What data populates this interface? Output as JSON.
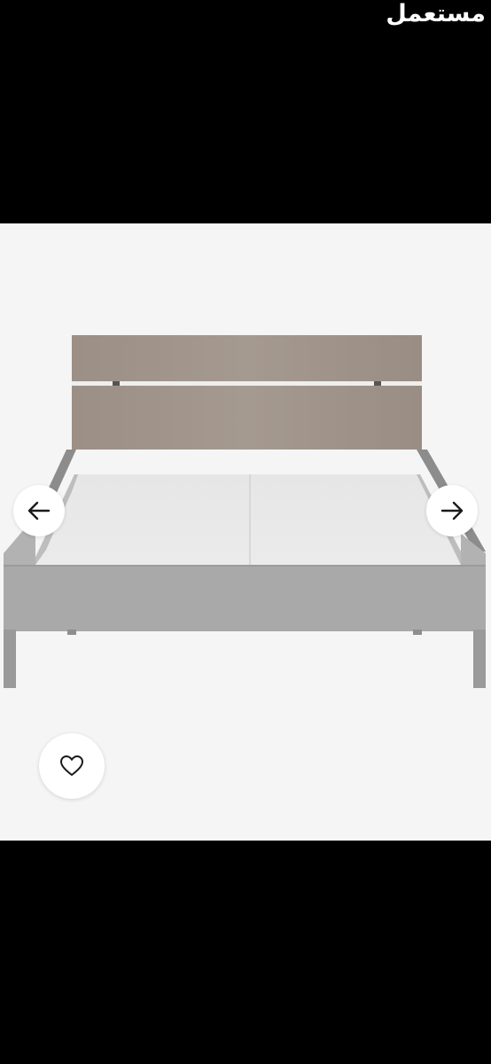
{
  "watermark": {
    "text": "مستعمل"
  },
  "gallery": {
    "image_description_icon": "bed-image",
    "prev_icon": "arrow-left-icon",
    "next_icon": "arrow-right-icon",
    "favorite_icon": "heart-icon"
  },
  "colors": {
    "background": "#000000",
    "image_background": "#f5f5f5",
    "button_background": "#ffffff",
    "icon_color": "#1a1a1a"
  }
}
